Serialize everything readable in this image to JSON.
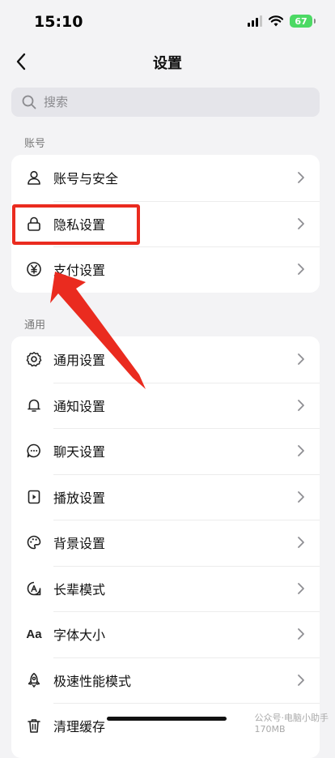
{
  "status_bar": {
    "time": "15:10",
    "battery": "67"
  },
  "nav": {
    "title": "设置"
  },
  "search": {
    "placeholder": "搜索"
  },
  "sections": [
    {
      "title": "账号",
      "items": [
        {
          "label": "账号与安全",
          "icon": "person-icon"
        },
        {
          "label": "隐私设置",
          "icon": "lock-icon"
        },
        {
          "label": "支付设置",
          "icon": "yen-icon"
        }
      ]
    },
    {
      "title": "通用",
      "items": [
        {
          "label": "通用设置",
          "icon": "gear-icon"
        },
        {
          "label": "通知设置",
          "icon": "bell-icon"
        },
        {
          "label": "聊天设置",
          "icon": "chat-bubble-icon"
        },
        {
          "label": "播放设置",
          "icon": "play-icon"
        },
        {
          "label": "背景设置",
          "icon": "palette-icon"
        },
        {
          "label": "长辈模式",
          "icon": "elder-mode-icon"
        },
        {
          "label": "字体大小",
          "icon": "font-size-icon",
          "icon_text": "Aa"
        },
        {
          "label": "极速性能模式",
          "icon": "rocket-icon"
        },
        {
          "label": "清理缓存",
          "icon": "trash-icon"
        }
      ]
    }
  ],
  "watermark": "公众号·电脑小助手",
  "cache_size": "170MB",
  "colors": {
    "background": "#f3f3f5",
    "card": "#ffffff",
    "highlight": "#ea2b1f",
    "battery": "#4cd964"
  }
}
